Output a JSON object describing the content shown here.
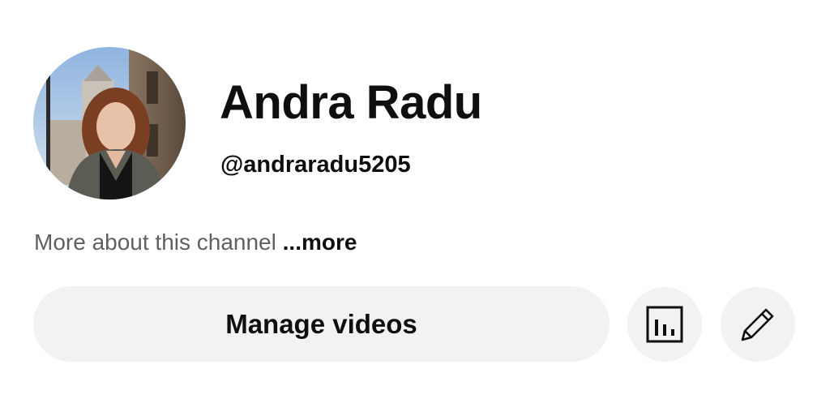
{
  "profile": {
    "name": "Andra Radu",
    "handle": "@andraradu5205",
    "about_text": "More about this channel ",
    "about_more": "...more"
  },
  "actions": {
    "manage_label": "Manage videos",
    "analytics_icon": "bar-chart-icon",
    "edit_icon": "pencil-icon"
  },
  "colors": {
    "button_bg": "#f2f2f2",
    "text_primary": "#0f0f0f",
    "text_secondary": "#606060"
  }
}
